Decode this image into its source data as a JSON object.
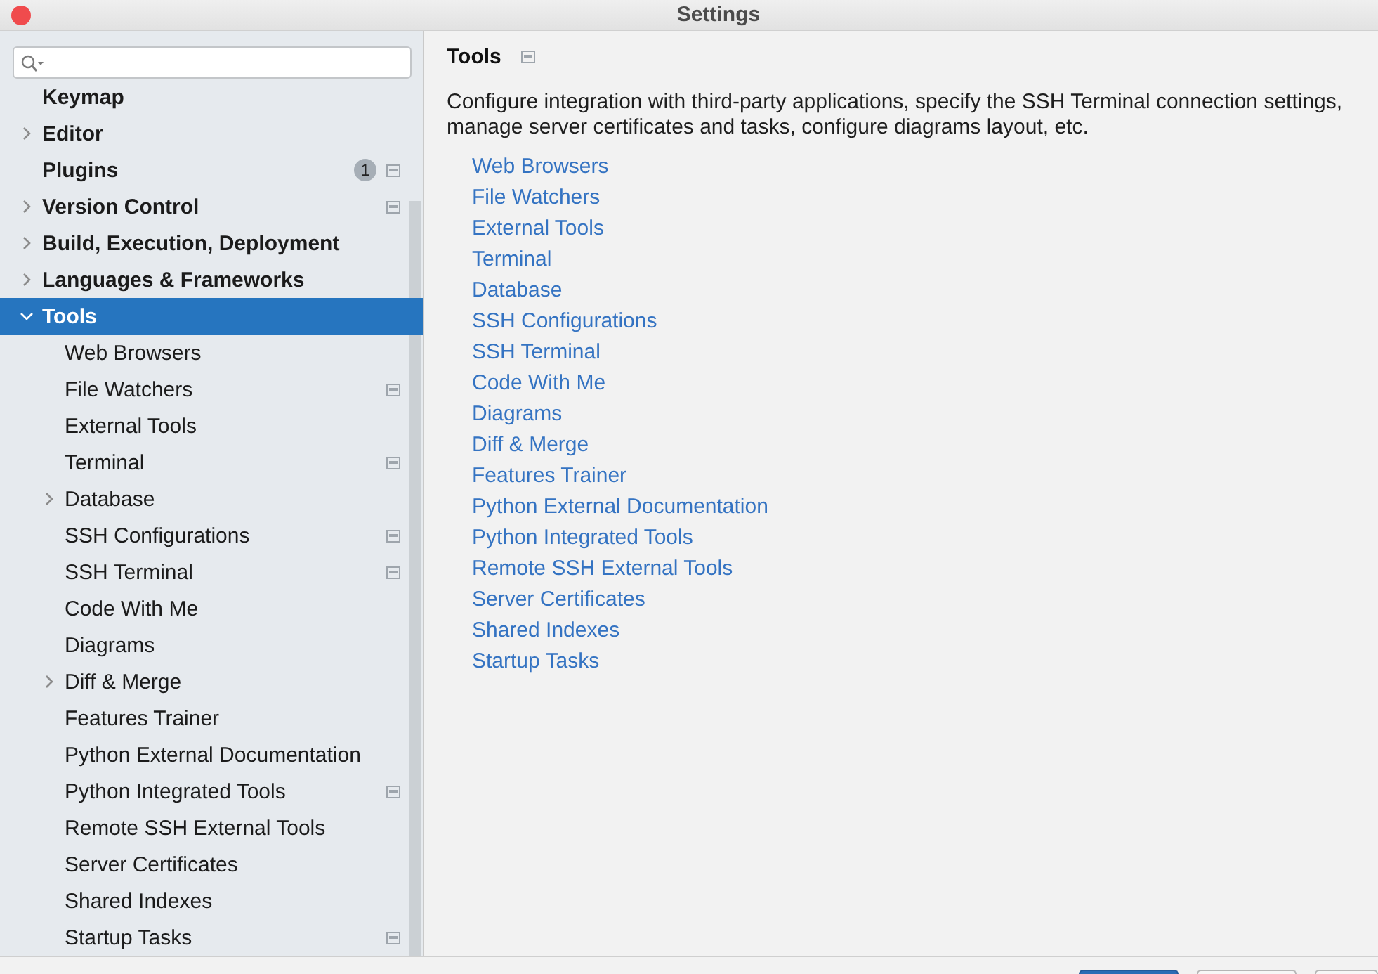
{
  "window": {
    "title": "Settings"
  },
  "sidebar": {
    "items": [
      {
        "label": "Keymap",
        "kind": "page",
        "expanded": false,
        "selected": false,
        "project_icon": false
      },
      {
        "label": "Editor",
        "kind": "group",
        "expanded": false,
        "selected": false,
        "project_icon": false
      },
      {
        "label": "Plugins",
        "kind": "page",
        "expanded": false,
        "selected": false,
        "project_icon": true,
        "badge": "1"
      },
      {
        "label": "Version Control",
        "kind": "group",
        "expanded": false,
        "selected": false,
        "project_icon": true
      },
      {
        "label": "Build, Execution, Deployment",
        "kind": "group",
        "expanded": false,
        "selected": false,
        "project_icon": false
      },
      {
        "label": "Languages & Frameworks",
        "kind": "group",
        "expanded": false,
        "selected": false,
        "project_icon": false
      },
      {
        "label": "Tools",
        "kind": "group",
        "expanded": true,
        "selected": true,
        "project_icon": false,
        "children": [
          {
            "label": "Web Browsers",
            "kind": "page",
            "expanded": false,
            "selected": false,
            "project_icon": false
          },
          {
            "label": "File Watchers",
            "kind": "page",
            "expanded": false,
            "selected": false,
            "project_icon": true
          },
          {
            "label": "External Tools",
            "kind": "page",
            "expanded": false,
            "selected": false,
            "project_icon": false
          },
          {
            "label": "Terminal",
            "kind": "page",
            "expanded": false,
            "selected": false,
            "project_icon": true
          },
          {
            "label": "Database",
            "kind": "group",
            "expanded": false,
            "selected": false,
            "project_icon": false
          },
          {
            "label": "SSH Configurations",
            "kind": "page",
            "expanded": false,
            "selected": false,
            "project_icon": true
          },
          {
            "label": "SSH Terminal",
            "kind": "page",
            "expanded": false,
            "selected": false,
            "project_icon": true
          },
          {
            "label": "Code With Me",
            "kind": "page",
            "expanded": false,
            "selected": false,
            "project_icon": false
          },
          {
            "label": "Diagrams",
            "kind": "page",
            "expanded": false,
            "selected": false,
            "project_icon": false
          },
          {
            "label": "Diff & Merge",
            "kind": "group",
            "expanded": false,
            "selected": false,
            "project_icon": false
          },
          {
            "label": "Features Trainer",
            "kind": "page",
            "expanded": false,
            "selected": false,
            "project_icon": false
          },
          {
            "label": "Python External Documentation",
            "kind": "page",
            "expanded": false,
            "selected": false,
            "project_icon": false
          },
          {
            "label": "Python Integrated Tools",
            "kind": "page",
            "expanded": false,
            "selected": false,
            "project_icon": true
          },
          {
            "label": "Remote SSH External Tools",
            "kind": "page",
            "expanded": false,
            "selected": false,
            "project_icon": false
          },
          {
            "label": "Server Certificates",
            "kind": "page",
            "expanded": false,
            "selected": false,
            "project_icon": false
          },
          {
            "label": "Shared Indexes",
            "kind": "page",
            "expanded": false,
            "selected": false,
            "project_icon": false
          },
          {
            "label": "Startup Tasks",
            "kind": "page",
            "expanded": false,
            "selected": false,
            "project_icon": true
          }
        ]
      }
    ]
  },
  "content": {
    "title": "Tools",
    "project_icon": true,
    "description": "Configure integration with third-party applications, specify the SSH Terminal connection settings, manage server certificates and tasks, configure diagrams layout, etc.",
    "links": [
      "Web Browsers",
      "File Watchers",
      "External Tools",
      "Terminal",
      "Database",
      "SSH Configurations",
      "SSH Terminal",
      "Code With Me",
      "Diagrams",
      "Diff & Merge",
      "Features Trainer",
      "Python External Documentation",
      "Python Integrated Tools",
      "Remote SSH External Tools",
      "Server Certificates",
      "Shared Indexes",
      "Startup Tasks"
    ]
  },
  "dialog_buttons": [
    {
      "default": true
    },
    {
      "default": false
    },
    {
      "default": false
    }
  ]
}
